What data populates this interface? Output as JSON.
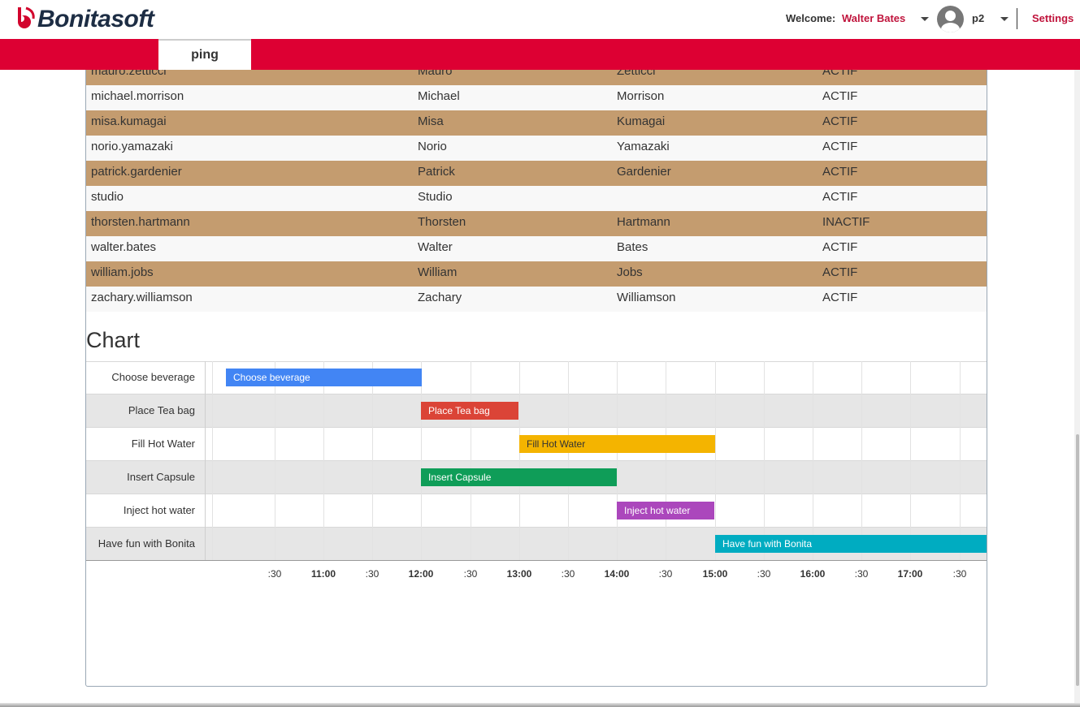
{
  "header": {
    "brand": "Bonitasoft",
    "welcome_label": "Welcome:",
    "user_name": "Walter Bates",
    "profile": "p2",
    "settings": "Settings"
  },
  "nav": {
    "tabs": [
      {
        "label": "ping"
      }
    ]
  },
  "users": {
    "rows": [
      {
        "username": "mauro.zetticci",
        "firstname": "Mauro",
        "lastname": "Zetticci",
        "status": "ACTIF"
      },
      {
        "username": "michael.morrison",
        "firstname": "Michael",
        "lastname": "Morrison",
        "status": "ACTIF"
      },
      {
        "username": "misa.kumagai",
        "firstname": "Misa",
        "lastname": "Kumagai",
        "status": "ACTIF"
      },
      {
        "username": "norio.yamazaki",
        "firstname": "Norio",
        "lastname": "Yamazaki",
        "status": "ACTIF"
      },
      {
        "username": "patrick.gardenier",
        "firstname": "Patrick",
        "lastname": "Gardenier",
        "status": "ACTIF"
      },
      {
        "username": "studio",
        "firstname": "Studio",
        "lastname": "",
        "status": "ACTIF"
      },
      {
        "username": "thorsten.hartmann",
        "firstname": "Thorsten",
        "lastname": "Hartmann",
        "status": "INACTIF"
      },
      {
        "username": "walter.bates",
        "firstname": "Walter",
        "lastname": "Bates",
        "status": "ACTIF"
      },
      {
        "username": "william.jobs",
        "firstname": "William",
        "lastname": "Jobs",
        "status": "ACTIF"
      },
      {
        "username": "zachary.williamson",
        "firstname": "Zachary",
        "lastname": "Williamson",
        "status": "ACTIF"
      }
    ]
  },
  "chart_section": {
    "title": "Chart"
  },
  "chart_data": {
    "type": "timeline",
    "x_ticks": [
      ":30",
      "11:00",
      ":30",
      "12:00",
      ":30",
      "13:00",
      ":30",
      "14:00",
      ":30",
      "15:00",
      ":30",
      "16:00",
      ":30",
      "17:00",
      ":30"
    ],
    "x_tick_hours": [
      10.5,
      11,
      11.5,
      12,
      12.5,
      13,
      13.5,
      14,
      14.5,
      15,
      15.5,
      16,
      16.5,
      17,
      17.5
    ],
    "x_range": [
      10.0,
      18.0
    ],
    "tasks": [
      {
        "row": "Choose beverage",
        "label": "Choose beverage",
        "start": "10:00",
        "end": "12:00",
        "color": "#4285f4"
      },
      {
        "row": "Place Tea bag",
        "label": "Place Tea bag",
        "start": "12:00",
        "end": "13:00",
        "color": "#db4437"
      },
      {
        "row": "Fill Hot Water",
        "label": "Fill Hot Water",
        "start": "13:00",
        "end": "15:00",
        "color": "#f4b400"
      },
      {
        "row": "Insert Capsule",
        "label": "Insert Capsule",
        "start": "12:00",
        "end": "14:00",
        "color": "#0f9d58"
      },
      {
        "row": "Inject hot water",
        "label": "Inject hot water",
        "start": "14:00",
        "end": "15:00",
        "color": "#ab47bc"
      },
      {
        "row": "Have fun with Bonita",
        "label": "Have fun with Bonita",
        "start": "15:00",
        "end": "18:00",
        "color": "#00acc1"
      }
    ]
  },
  "colors": {
    "brand_red": "#dd0033",
    "row_alt": "#c49c6f",
    "link": "#c0143c"
  }
}
